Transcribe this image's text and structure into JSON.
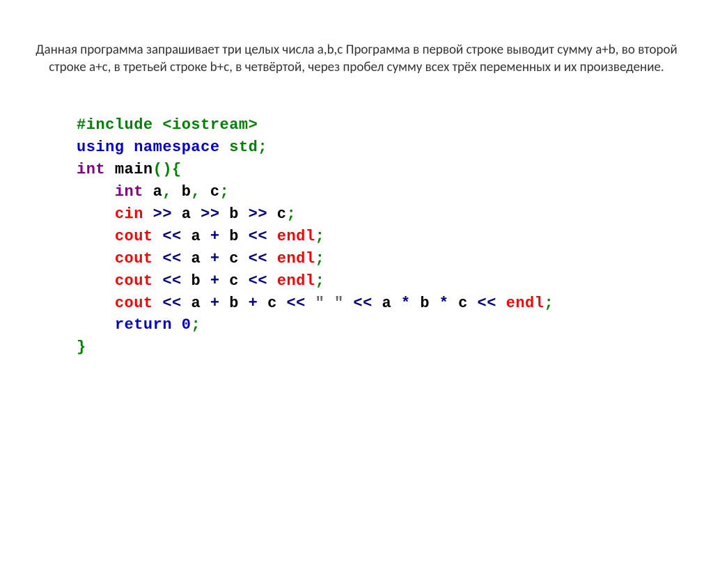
{
  "description": "Данная программа запрашивает три целых числа a,b,c  Программа в первой строке выводит сумму a+b, во второй строке a+c, в третьей строке b+c, в четвёртой, через пробел сумму всех трёх переменных и их произведение.",
  "code": {
    "l1_include": "#include <iostream>",
    "l2_using": "using",
    "l2_namespace": "namespace",
    "l2_std": "std",
    "l2_semi": ";",
    "l3_int": "int",
    "l3_main": "main",
    "l3_parens": "()",
    "l3_brace": "{",
    "l4_int": "int",
    "l4_a": "a",
    "l4_c1": ",",
    "l4_b": "b",
    "l4_c2": ",",
    "l4_c": "c",
    "l4_semi": ";",
    "l5_cin": "cin",
    "l5_op1": ">>",
    "l5_a": "a",
    "l5_op2": ">>",
    "l5_b": "b",
    "l5_op3": ">>",
    "l5_c": "c",
    "l5_semi": ";",
    "l6_cout": "cout",
    "l6_op1": "<<",
    "l6_a": "a",
    "l6_plus": "+",
    "l6_b": "b",
    "l6_op2": "<<",
    "l6_endl": "endl",
    "l6_semi": ";",
    "l7_cout": "cout",
    "l7_op1": "<<",
    "l7_a": "a",
    "l7_plus": "+",
    "l7_c": "c",
    "l7_op2": "<<",
    "l7_endl": "endl",
    "l7_semi": ";",
    "l8_cout": "cout",
    "l8_op1": "<<",
    "l8_b": "b",
    "l8_plus": "+",
    "l8_c": "c",
    "l8_op2": "<<",
    "l8_endl": "endl",
    "l8_semi": ";",
    "l9_cout": "cout",
    "l9_op1": "<<",
    "l9_a1": "a",
    "l9_p1": "+",
    "l9_b1": "b",
    "l9_p2": "+",
    "l9_c1": "c",
    "l9_op2": "<<",
    "l9_str": "\" \"",
    "l9_op3": "<<",
    "l9_a2": "a",
    "l9_m1": "*",
    "l9_b2": "b",
    "l9_m2": "*",
    "l9_c2": "c",
    "l9_op4": "<<",
    "l9_endl": "endl",
    "l9_semi": ";",
    "l10_return": "return",
    "l10_zero": "0",
    "l10_semi": ";",
    "l11_brace": "}"
  }
}
